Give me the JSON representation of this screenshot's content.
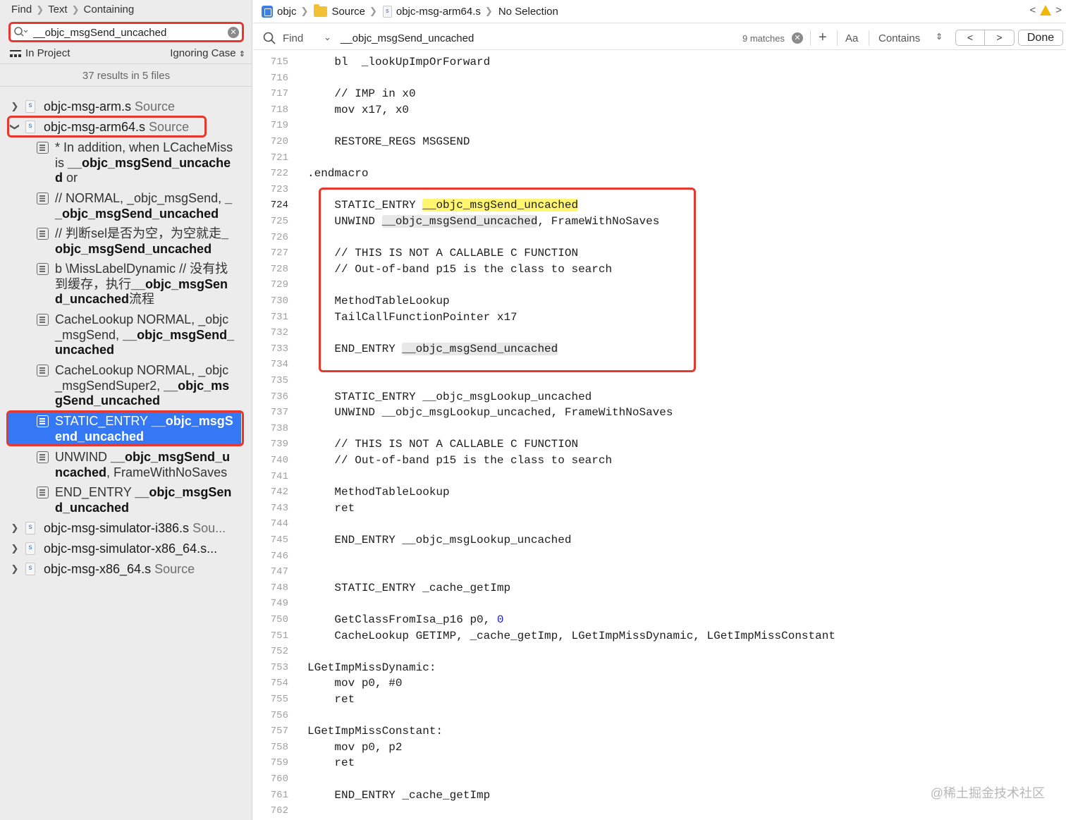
{
  "navigator": {
    "breadcrumb": [
      "Find",
      "Text",
      "Containing"
    ],
    "search_value": "__objc_msgSend_uncached",
    "scope": "In Project",
    "case_mode": "Ignoring Case",
    "summary": "37 results in 5 files",
    "files": [
      {
        "name": "objc-msg-arm.s",
        "location": "Source",
        "expanded": false
      },
      {
        "name": "objc-msg-arm64.s",
        "location": "Source",
        "expanded": true
      },
      {
        "name": "objc-msg-simulator-i386.s",
        "location": "Sou...",
        "expanded": false
      },
      {
        "name": "objc-msg-simulator-x86_64.s...",
        "location": "",
        "expanded": false
      },
      {
        "name": "objc-msg-x86_64.s",
        "location": "Source",
        "expanded": false
      }
    ],
    "matches": [
      {
        "pre": "*        In addition, when LCacheMiss is ",
        "hit": "__objc_msgSend_uncached",
        "post": " or"
      },
      {
        "pre": "// NORMAL, _objc_msgSend, ",
        "hit": "__objc_msgSend_uncached",
        "post": ""
      },
      {
        "pre": "// 判断sel是否为空，为空就走",
        "hit": "_objc_msgSend_uncached",
        "post": ""
      },
      {
        "pre": "b      \\MissLabelDynamic // 没有找到缓存，执行",
        "hit": "__objc_msgSend_uncached",
        "post": "流程"
      },
      {
        "pre": "CacheLookup NORMAL, _objc_msgSend, ",
        "hit": "__objc_msgSend_uncached",
        "post": ""
      },
      {
        "pre": "CacheLookup NORMAL, _objc_msgSendSuper2, ",
        "hit": "__objc_msgSend_uncached",
        "post": ""
      },
      {
        "pre": "STATIC_ENTRY ",
        "hit": "__objc_msgSend_uncached",
        "post": ""
      },
      {
        "pre": "UNWIND ",
        "hit": "__objc_msgSend_uncached",
        "post": ", FrameWithNoSaves"
      },
      {
        "pre": "END_ENTRY ",
        "hit": "__objc_msgSend_uncached",
        "post": ""
      }
    ]
  },
  "jumpbar": {
    "project": "objc",
    "folder": "Source",
    "file": "objc-msg-arm64.s",
    "selection": "No Selection",
    "nav_prev": "<",
    "nav_next": ">"
  },
  "findbar": {
    "mode": "Find",
    "query": "__objc_msgSend_uncached",
    "matches": "9 matches",
    "add": "+",
    "case": "Aa",
    "match_mode": "Contains",
    "prev": "<",
    "next": ">",
    "done": "Done"
  },
  "code": {
    "current_line": 724,
    "lines": [
      {
        "n": 715,
        "t": "    bl  _lookUpImpOrForward"
      },
      {
        "n": 716,
        "t": ""
      },
      {
        "n": 717,
        "t": "    // IMP in x0"
      },
      {
        "n": 718,
        "t": "    mov x17, x0"
      },
      {
        "n": 719,
        "t": ""
      },
      {
        "n": 720,
        "t": "    RESTORE_REGS MSGSEND"
      },
      {
        "n": 721,
        "t": ""
      },
      {
        "n": 722,
        "t": ".endmacro"
      },
      {
        "n": 723,
        "t": ""
      },
      {
        "n": 724,
        "t": "    STATIC_ENTRY ",
        "hit": "__objc_msgSend_uncached",
        "hl": "yellow"
      },
      {
        "n": 725,
        "t": "    UNWIND ",
        "hit": "__objc_msgSend_uncached",
        "post": ", FrameWithNoSaves",
        "hl": "gray"
      },
      {
        "n": 726,
        "t": ""
      },
      {
        "n": 727,
        "t": "    // THIS IS NOT A CALLABLE C FUNCTION"
      },
      {
        "n": 728,
        "t": "    // Out-of-band p15 is the class to search"
      },
      {
        "n": 729,
        "t": ""
      },
      {
        "n": 730,
        "t": "    MethodTableLookup"
      },
      {
        "n": 731,
        "t": "    TailCallFunctionPointer x17"
      },
      {
        "n": 732,
        "t": ""
      },
      {
        "n": 733,
        "t": "    END_ENTRY ",
        "hit": "__objc_msgSend_uncached",
        "hl": "gray"
      },
      {
        "n": 734,
        "t": ""
      },
      {
        "n": 735,
        "t": ""
      },
      {
        "n": 736,
        "t": "    STATIC_ENTRY __objc_msgLookup_uncached"
      },
      {
        "n": 737,
        "t": "    UNWIND __objc_msgLookup_uncached, FrameWithNoSaves"
      },
      {
        "n": 738,
        "t": ""
      },
      {
        "n": 739,
        "t": "    // THIS IS NOT A CALLABLE C FUNCTION"
      },
      {
        "n": 740,
        "t": "    // Out-of-band p15 is the class to search"
      },
      {
        "n": 741,
        "t": ""
      },
      {
        "n": 742,
        "t": "    MethodTableLookup"
      },
      {
        "n": 743,
        "t": "    ret"
      },
      {
        "n": 744,
        "t": ""
      },
      {
        "n": 745,
        "t": "    END_ENTRY __objc_msgLookup_uncached"
      },
      {
        "n": 746,
        "t": ""
      },
      {
        "n": 747,
        "t": ""
      },
      {
        "n": 748,
        "t": "    STATIC_ENTRY _cache_getImp"
      },
      {
        "n": 749,
        "t": ""
      },
      {
        "n": 750,
        "t": "    GetClassFromIsa_p16 p0, ",
        "zero": "0"
      },
      {
        "n": 751,
        "t": "    CacheLookup GETIMP, _cache_getImp, LGetImpMissDynamic, LGetImpMissConstant"
      },
      {
        "n": 752,
        "t": ""
      },
      {
        "n": 753,
        "t": "LGetImpMissDynamic:"
      },
      {
        "n": 754,
        "t": "    mov p0, #0"
      },
      {
        "n": 755,
        "t": "    ret"
      },
      {
        "n": 756,
        "t": ""
      },
      {
        "n": 757,
        "t": "LGetImpMissConstant:"
      },
      {
        "n": 758,
        "t": "    mov p0, p2"
      },
      {
        "n": 759,
        "t": "    ret"
      },
      {
        "n": 760,
        "t": ""
      },
      {
        "n": 761,
        "t": "    END_ENTRY _cache_getImp"
      },
      {
        "n": 762,
        "t": ""
      }
    ]
  },
  "watermark": "@稀土掘金技术社区"
}
